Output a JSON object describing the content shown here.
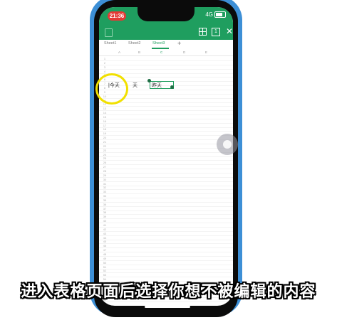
{
  "status": {
    "time": "21:36",
    "network": "4G"
  },
  "toolbar": {
    "grid_icon": "grid-icon",
    "one_label": "1",
    "close_icon": "close-icon"
  },
  "sheets": {
    "tabs": [
      {
        "label": "Sheet1"
      },
      {
        "label": "Sheet2"
      },
      {
        "label": "Sheet3"
      }
    ],
    "active": "Sheet3",
    "add_label": "+"
  },
  "columns": [
    "A",
    "B",
    "C",
    "D",
    "E"
  ],
  "selected_column": "C",
  "rows": [
    "1",
    "2",
    "3",
    "4",
    "5",
    "6",
    "7",
    "8",
    "9",
    "10",
    "11",
    "12",
    "13",
    "14",
    "15",
    "16",
    "17",
    "18",
    "19",
    "20",
    "21",
    "22",
    "23",
    "24",
    "25",
    "26",
    "27",
    "28",
    "29",
    "30",
    "31",
    "32",
    "33",
    "34",
    "35",
    "36",
    "37",
    "38",
    "39",
    "40",
    "41",
    "42",
    "43",
    "44",
    "45",
    "46",
    "47",
    "48",
    "49",
    "50",
    "51",
    "52",
    "53",
    "54",
    "55",
    "56",
    "57",
    "58",
    "59",
    "60"
  ],
  "cells": {
    "a_text": "|今天",
    "b_text": "天",
    "c_text": "昨天"
  },
  "caption": "进入表格页面后选择你想不被编辑的内容",
  "colors": {
    "toolbar": "#1f9e5f",
    "phone_frame": "#3d8fd6",
    "highlight_circle": "#f1e000"
  }
}
